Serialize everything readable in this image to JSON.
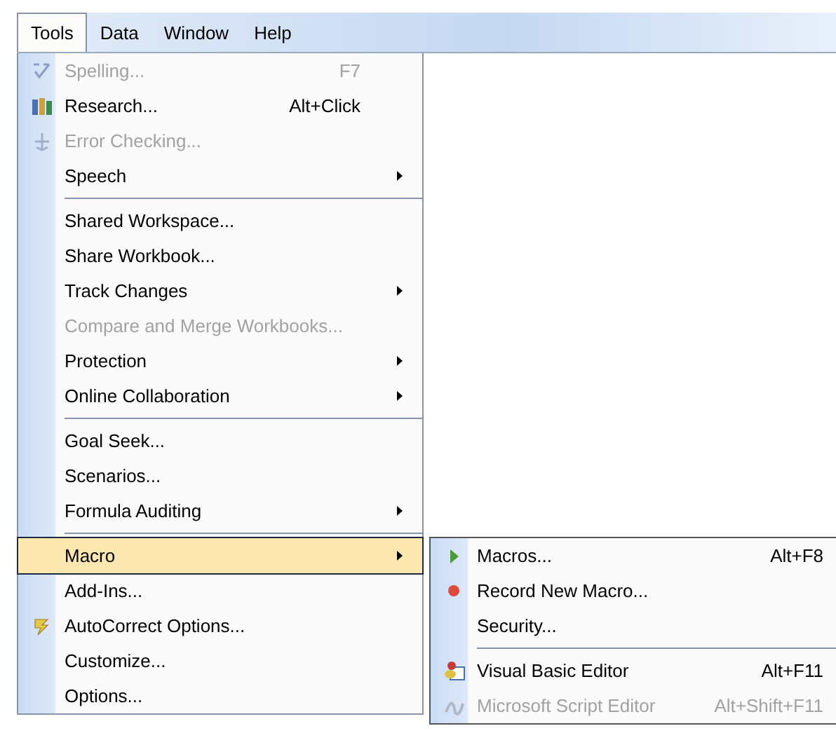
{
  "menubar": [
    {
      "label": "Tools",
      "selected": true
    },
    {
      "label": "Data",
      "selected": false
    },
    {
      "label": "Window",
      "selected": false
    },
    {
      "label": "Help",
      "selected": false
    }
  ],
  "menu": {
    "items": [
      {
        "kind": "item",
        "label": "Spelling...",
        "shortcut": "F7",
        "disabled": true,
        "has_submenu": false,
        "selected": false
      },
      {
        "kind": "item",
        "label": "Research...",
        "shortcut": "Alt+Click",
        "disabled": false,
        "has_submenu": false,
        "selected": false
      },
      {
        "kind": "item",
        "label": "Error Checking...",
        "disabled": true,
        "has_submenu": false,
        "selected": false
      },
      {
        "kind": "item",
        "label": "Speech",
        "disabled": false,
        "has_submenu": true,
        "selected": false
      },
      {
        "kind": "separator"
      },
      {
        "kind": "item",
        "label": "Shared Workspace...",
        "disabled": false,
        "has_submenu": false,
        "selected": false
      },
      {
        "kind": "item",
        "label": "Share Workbook...",
        "disabled": false,
        "has_submenu": false,
        "selected": false
      },
      {
        "kind": "item",
        "label": "Track Changes",
        "disabled": false,
        "has_submenu": true,
        "selected": false
      },
      {
        "kind": "item",
        "label": "Compare and Merge Workbooks...",
        "disabled": true,
        "has_submenu": false,
        "selected": false
      },
      {
        "kind": "item",
        "label": "Protection",
        "disabled": false,
        "has_submenu": true,
        "selected": false
      },
      {
        "kind": "item",
        "label": "Online Collaboration",
        "disabled": false,
        "has_submenu": true,
        "selected": false
      },
      {
        "kind": "separator"
      },
      {
        "kind": "item",
        "label": "Goal Seek...",
        "disabled": false,
        "has_submenu": false,
        "selected": false
      },
      {
        "kind": "item",
        "label": "Scenarios...",
        "disabled": false,
        "has_submenu": false,
        "selected": false
      },
      {
        "kind": "item",
        "label": "Formula Auditing",
        "disabled": false,
        "has_submenu": true,
        "selected": false
      },
      {
        "kind": "separator"
      },
      {
        "kind": "item",
        "label": "Macro",
        "disabled": false,
        "has_submenu": true,
        "selected": true,
        "submenu": [
          {
            "kind": "item",
            "label": "Macros...",
            "shortcut": "Alt+F8",
            "disabled": false
          },
          {
            "kind": "item",
            "label": "Record New Macro...",
            "disabled": false
          },
          {
            "kind": "item",
            "label": "Security...",
            "disabled": false
          },
          {
            "kind": "separator"
          },
          {
            "kind": "item",
            "label": "Visual Basic Editor",
            "shortcut": "Alt+F11",
            "disabled": false
          },
          {
            "kind": "item",
            "label": "Microsoft Script Editor",
            "shortcut": "Alt+Shift+F11",
            "disabled": true
          }
        ]
      },
      {
        "kind": "item",
        "label": "Add-Ins...",
        "disabled": false,
        "has_submenu": false,
        "selected": false
      },
      {
        "kind": "item",
        "label": "AutoCorrect Options...",
        "disabled": false,
        "has_submenu": false,
        "selected": false
      },
      {
        "kind": "item",
        "label": "Customize...",
        "disabled": false,
        "has_submenu": false,
        "selected": false
      },
      {
        "kind": "item",
        "label": "Options...",
        "disabled": false,
        "has_submenu": false,
        "selected": false
      }
    ]
  }
}
